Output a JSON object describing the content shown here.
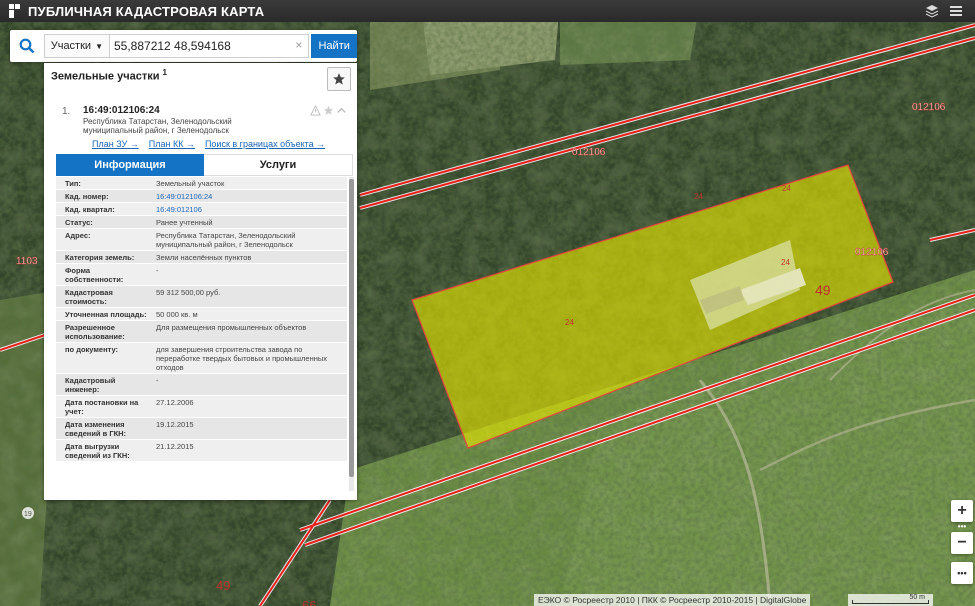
{
  "app": {
    "title": "ПУБЛИЧНАЯ КАДАСТРОВАЯ КАРТА"
  },
  "search": {
    "type_label": "Участки",
    "query": "55,887212 48,594168",
    "button_label": "Найти",
    "clear_symbol": "×"
  },
  "results": {
    "title": "Земельные участки",
    "count": "1",
    "item": {
      "index": "1.",
      "cad_number": "16:49:012106:24",
      "address": "Республика Татарстан, Зеленодольский муниципальный район, г Зеленодольск",
      "links": [
        "План ЗУ →",
        "План КК →",
        "Поиск в границах объекта →"
      ]
    },
    "tabs": {
      "info": "Информация",
      "services": "Услуги"
    },
    "attributes": [
      {
        "label": "Тип:",
        "value": "Земельный участок"
      },
      {
        "label": "Кад. номер:",
        "value": "16:49:012106:24",
        "link": true
      },
      {
        "label": "Кад. квартал:",
        "value": "16:49:012106",
        "link": true
      },
      {
        "label": "Статус:",
        "value": "Ранее учтенный"
      },
      {
        "label": "Адрес:",
        "value": "Республика Татарстан, Зеленодольский муниципальный район, г Зеленодольск"
      },
      {
        "label": "Категория земель:",
        "value": "Земли населённых пунктов"
      },
      {
        "label": "Форма собственности:",
        "value": "-"
      },
      {
        "label": "Кадастровая стоимость:",
        "value": "59 312 500,00 руб."
      },
      {
        "label": "Уточненная площадь:",
        "value": "50 000 кв. м"
      },
      {
        "label": "Разрешенное использование:",
        "value": "Для размещения промышленных объектов"
      },
      {
        "label": "по документу:",
        "value": "для завершения строительства завода по переработке твердых бытовых и промышленных отходов"
      },
      {
        "label": "Кадастровый инженер:",
        "value": "-"
      },
      {
        "label": "Дата постановки на учет:",
        "value": "27.12.2006"
      },
      {
        "label": "Дата изменения сведений в ГКН:",
        "value": "19.12.2015"
      },
      {
        "label": "Дата выгрузки сведений из ГКН:",
        "value": "21.12.2015"
      }
    ]
  },
  "map": {
    "labels": {
      "quarter_a": "012106",
      "quarter_b": "012106",
      "quarter_c": "012106",
      "left_edge": "1103",
      "block_49": "49",
      "block_49_bottom": "49",
      "parcel_24": "24",
      "mark_19": "19",
      "mark_bottom": "66"
    },
    "colors": {
      "parcel_fill": "#e6e600",
      "parcel_edge": "#e8453c",
      "boundary": "#e8201c",
      "accent": "#1473c4"
    }
  },
  "controls": {
    "zoom_in": "+",
    "zoom_out": "−",
    "more": "•••"
  },
  "attribution": "ЕЭКО © Росреестр 2010 | ПКК © Росреестр 2010-2015 | DigitalGlobe",
  "scale_label": "50 m"
}
